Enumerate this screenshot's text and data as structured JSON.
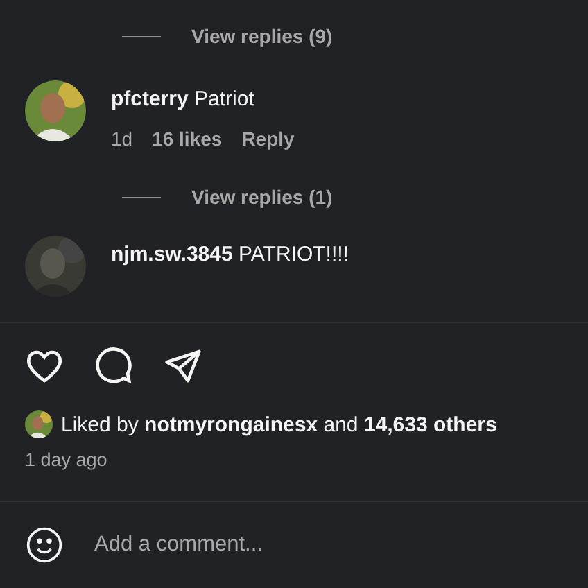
{
  "comments": [
    {
      "kind": "replies",
      "label": "View replies (9)"
    },
    {
      "kind": "comment",
      "username": "pfcterry",
      "text": "Patriot",
      "time": "1d",
      "likes": "16 likes",
      "reply": "Reply"
    },
    {
      "kind": "replies",
      "label": "View replies (1)"
    },
    {
      "kind": "comment",
      "username": "njm.sw.3845",
      "text": "PATRIOT!!!!"
    }
  ],
  "liked_by": {
    "text": "Liked by **notmyrongainesx** and **14,633 others**"
  },
  "timestamp": "1 day ago",
  "comment_field": {
    "placeholder": "Add a comment..."
  }
}
